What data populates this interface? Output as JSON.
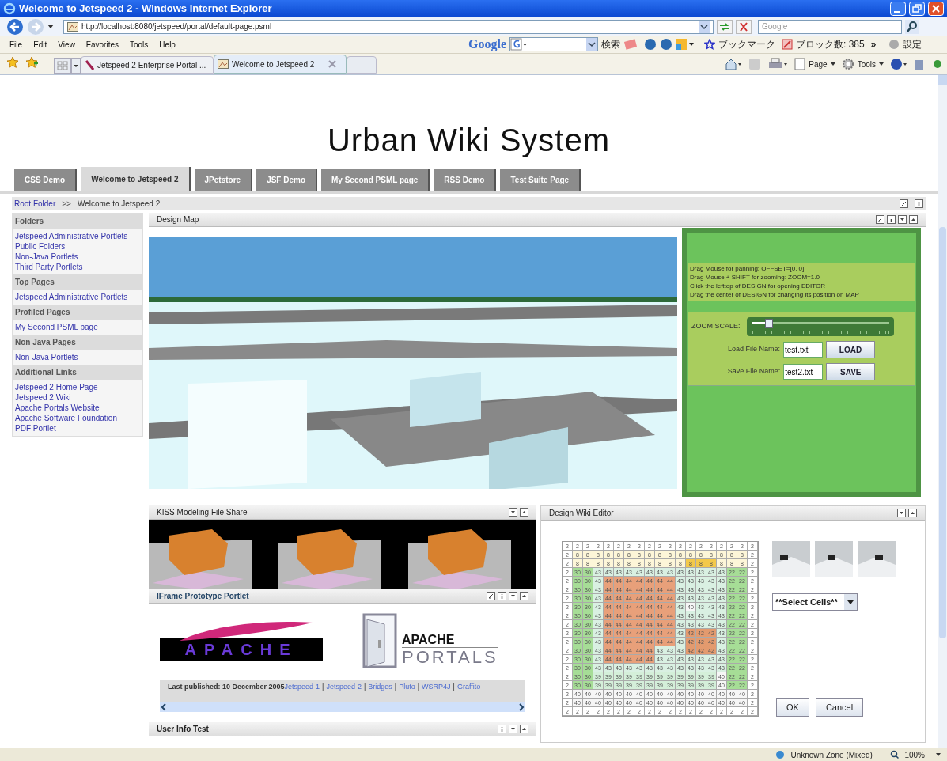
{
  "window": {
    "title": "Welcome to Jetspeed 2 - Windows Internet Explorer"
  },
  "address_bar": {
    "url": "http://localhost:8080/jetspeed/portal/default-page.psml"
  },
  "search_box": {
    "placeholder": "Google"
  },
  "menu_bar": [
    "File",
    "Edit",
    "View",
    "Favorites",
    "Tools",
    "Help"
  ],
  "google_toolbar": {
    "logo": "Google",
    "search_button": "検索",
    "bookmarks": "ブックマーク",
    "blocked": "ブロック数: 385",
    "more": "»",
    "settings": "設定"
  },
  "browser_tabs": [
    {
      "label": "Jetspeed 2 Enterprise Portal ...",
      "selected": false
    },
    {
      "label": "Welcome to Jetspeed 2",
      "selected": true
    }
  ],
  "command_bar": [
    "Page",
    "Tools"
  ],
  "page": {
    "heading": "Urban Wiki System"
  },
  "portal_tabs": [
    {
      "label": "CSS Demo",
      "selected": false
    },
    {
      "label": "Welcome to Jetspeed 2",
      "selected": true
    },
    {
      "label": "JPetstore",
      "selected": false
    },
    {
      "label": "JSF Demo",
      "selected": false
    },
    {
      "label": "My Second PSML page",
      "selected": false
    },
    {
      "label": "RSS Demo",
      "selected": false
    },
    {
      "label": "Test Suite Page",
      "selected": false
    }
  ],
  "breadcrumb": {
    "link": "Root Folder",
    "separator": ">>",
    "current": "Welcome to Jetspeed 2"
  },
  "sidebar": [
    {
      "heading": "Folders",
      "links": [
        "Jetspeed Administrative Portlets",
        "Public Folders",
        "Non-Java Portlets",
        "Third Party Portlets"
      ]
    },
    {
      "heading": "Top Pages",
      "links": [
        "Jetspeed Administrative Portlets"
      ]
    },
    {
      "heading": "Profiled Pages",
      "links": [
        "My Second PSML page"
      ]
    },
    {
      "heading": "Non Java Pages",
      "links": [
        "Non-Java Portlets"
      ]
    },
    {
      "heading": "Additional Links",
      "links": [
        "Jetspeed 2 Home Page",
        "Jetspeed 2 Wiki",
        "Apache Portals Website",
        "Apache Software Foundation",
        "PDF Portlet"
      ]
    }
  ],
  "design_map": {
    "title": "Design Map",
    "instructions": [
      "Drag Mouse for panning: OFFSET=[0, 0]",
      "Drag Mouse + SHIFT for zooming: ZOOM=1.0",
      "Click the lefttop of DESIGN for opening EDITOR",
      "Drag the center of DESIGN for changing its position on MAP"
    ],
    "zoom_label": "ZOOM SCALE:",
    "zoom": {
      "level": 0.1
    },
    "load_label": "Load File Name:",
    "load_value": "test.txt",
    "load_button": "LOAD",
    "save_label": "Save File Name:",
    "save_value": "test2.txt",
    "save_button": "SAVE"
  },
  "file_share": {
    "title": "KISS Modeling File Share"
  },
  "iframe_portlet": {
    "title": "IFrame Prototype Portlet",
    "apache_logo": "APACHE",
    "portals_logo_top": "APACHE",
    "portals_logo_bottom": "PORTALS",
    "footer_text": "Last published: 10 December 2005",
    "footer_separator": "|",
    "footer_links": [
      "Jetspeed-1",
      "Jetspeed-2",
      "Bridges",
      "Pluto",
      "WSRP4J",
      "Graffito"
    ]
  },
  "user_info": {
    "title": "User Info Test"
  },
  "wiki_editor": {
    "title": "Design Wiki Editor",
    "select": "**Select Cells**",
    "buttons": [
      "OK",
      "Cancel"
    ],
    "grid": [
      {
        "cells": [
          "2",
          "2",
          "2",
          "2",
          "2",
          "2",
          "2",
          "2",
          "2",
          "2",
          "2",
          "2",
          "2",
          "2",
          "2",
          "2",
          "2",
          "2",
          "2"
        ],
        "selected": [
          false,
          false,
          false,
          false,
          false,
          false,
          false,
          false,
          false,
          false,
          false,
          false,
          false,
          false,
          false,
          false,
          false,
          false,
          false
        ]
      },
      {
        "cells": [
          "2",
          "8",
          "8",
          "8",
          "8",
          "8",
          "8",
          "8",
          "8",
          "8",
          "8",
          "8",
          "8",
          "8",
          "8",
          "8",
          "8",
          "8",
          "2"
        ],
        "selected": [
          false,
          false,
          false,
          false,
          false,
          false,
          false,
          false,
          false,
          false,
          false,
          false,
          false,
          false,
          false,
          false,
          false,
          false,
          false
        ]
      },
      {
        "cells": [
          "2",
          "8",
          "8",
          "8",
          "8",
          "8",
          "8",
          "8",
          "8",
          "8",
          "8",
          "8",
          "8",
          "8",
          "8",
          "8",
          "8",
          "8",
          "2"
        ],
        "selected": [
          false,
          false,
          false,
          false,
          false,
          false,
          false,
          false,
          false,
          false,
          false,
          false,
          true,
          true,
          true,
          false,
          false,
          false,
          false
        ]
      },
      {
        "cells": [
          "2",
          "30",
          "30",
          "43",
          "43",
          "43",
          "43",
          "43",
          "43",
          "43",
          "43",
          "43",
          "43",
          "43",
          "43",
          "43",
          "22",
          "22",
          "2"
        ],
        "selected": [
          false,
          false,
          false,
          false,
          false,
          false,
          false,
          false,
          false,
          false,
          false,
          false,
          false,
          false,
          false,
          false,
          false,
          false,
          false
        ]
      },
      {
        "cells": [
          "2",
          "30",
          "30",
          "43",
          "44",
          "44",
          "44",
          "44",
          "44",
          "44",
          "44",
          "43",
          "43",
          "43",
          "43",
          "43",
          "22",
          "22",
          "2"
        ],
        "selected": [
          false,
          false,
          false,
          false,
          false,
          false,
          false,
          false,
          false,
          false,
          false,
          false,
          false,
          false,
          false,
          false,
          false,
          false,
          false
        ]
      },
      {
        "cells": [
          "2",
          "30",
          "30",
          "43",
          "44",
          "44",
          "44",
          "44",
          "44",
          "44",
          "44",
          "43",
          "43",
          "43",
          "43",
          "43",
          "22",
          "22",
          "2"
        ],
        "selected": [
          false,
          false,
          false,
          false,
          false,
          false,
          false,
          false,
          false,
          false,
          false,
          false,
          false,
          false,
          false,
          false,
          false,
          false,
          false
        ]
      },
      {
        "cells": [
          "2",
          "30",
          "30",
          "43",
          "44",
          "44",
          "44",
          "44",
          "44",
          "44",
          "44",
          "43",
          "43",
          "43",
          "43",
          "43",
          "22",
          "22",
          "2"
        ],
        "selected": [
          false,
          false,
          false,
          false,
          false,
          false,
          false,
          false,
          false,
          false,
          false,
          false,
          false,
          false,
          false,
          false,
          false,
          false,
          false
        ]
      },
      {
        "cells": [
          "2",
          "30",
          "30",
          "43",
          "44",
          "44",
          "44",
          "44",
          "44",
          "44",
          "44",
          "43",
          "40",
          "43",
          "43",
          "43",
          "22",
          "22",
          "2"
        ],
        "selected": [
          false,
          false,
          false,
          false,
          false,
          false,
          false,
          false,
          false,
          false,
          false,
          false,
          false,
          false,
          false,
          false,
          false,
          false,
          false
        ]
      },
      {
        "cells": [
          "2",
          "30",
          "30",
          "43",
          "44",
          "44",
          "44",
          "44",
          "44",
          "44",
          "44",
          "43",
          "43",
          "43",
          "43",
          "43",
          "22",
          "22",
          "2"
        ],
        "selected": [
          false,
          false,
          false,
          false,
          false,
          false,
          false,
          false,
          false,
          false,
          false,
          false,
          false,
          false,
          false,
          false,
          false,
          false,
          false
        ]
      },
      {
        "cells": [
          "2",
          "30",
          "30",
          "43",
          "44",
          "44",
          "44",
          "44",
          "44",
          "44",
          "44",
          "43",
          "43",
          "43",
          "43",
          "43",
          "22",
          "22",
          "2"
        ],
        "selected": [
          false,
          false,
          false,
          false,
          false,
          false,
          false,
          false,
          false,
          false,
          false,
          false,
          false,
          false,
          false,
          false,
          false,
          false,
          false
        ]
      },
      {
        "cells": [
          "2",
          "30",
          "30",
          "43",
          "44",
          "44",
          "44",
          "44",
          "44",
          "44",
          "44",
          "43",
          "42",
          "42",
          "42",
          "43",
          "22",
          "22",
          "2"
        ],
        "selected": [
          false,
          false,
          false,
          false,
          false,
          false,
          false,
          false,
          false,
          false,
          false,
          false,
          false,
          false,
          false,
          false,
          false,
          false,
          false
        ]
      },
      {
        "cells": [
          "2",
          "30",
          "30",
          "43",
          "44",
          "44",
          "44",
          "44",
          "44",
          "44",
          "44",
          "43",
          "42",
          "42",
          "42",
          "43",
          "22",
          "22",
          "2"
        ],
        "selected": [
          false,
          false,
          false,
          false,
          false,
          false,
          false,
          false,
          false,
          false,
          false,
          false,
          false,
          false,
          false,
          false,
          false,
          false,
          false
        ]
      },
      {
        "cells": [
          "2",
          "30",
          "30",
          "43",
          "44",
          "44",
          "44",
          "44",
          "44",
          "43",
          "43",
          "43",
          "42",
          "42",
          "42",
          "43",
          "22",
          "22",
          "2"
        ],
        "selected": [
          false,
          false,
          false,
          false,
          false,
          false,
          false,
          false,
          false,
          false,
          false,
          false,
          false,
          false,
          false,
          false,
          false,
          false,
          false
        ]
      },
      {
        "cells": [
          "2",
          "30",
          "30",
          "43",
          "44",
          "44",
          "44",
          "44",
          "44",
          "43",
          "43",
          "43",
          "43",
          "43",
          "43",
          "43",
          "22",
          "22",
          "2"
        ],
        "selected": [
          false,
          false,
          false,
          false,
          false,
          false,
          false,
          false,
          false,
          false,
          false,
          false,
          false,
          false,
          false,
          false,
          false,
          false,
          false
        ]
      },
      {
        "cells": [
          "2",
          "30",
          "30",
          "43",
          "43",
          "43",
          "43",
          "43",
          "43",
          "43",
          "43",
          "43",
          "43",
          "43",
          "43",
          "43",
          "22",
          "22",
          "2"
        ],
        "selected": [
          false,
          false,
          false,
          false,
          false,
          false,
          false,
          false,
          false,
          false,
          false,
          false,
          false,
          false,
          false,
          false,
          false,
          false,
          false
        ]
      },
      {
        "cells": [
          "2",
          "30",
          "30",
          "39",
          "39",
          "39",
          "39",
          "39",
          "39",
          "39",
          "39",
          "39",
          "39",
          "39",
          "39",
          "40",
          "22",
          "22",
          "2"
        ],
        "selected": [
          false,
          false,
          false,
          false,
          false,
          false,
          false,
          false,
          false,
          false,
          false,
          false,
          false,
          false,
          false,
          false,
          false,
          false,
          false
        ]
      },
      {
        "cells": [
          "2",
          "30",
          "30",
          "39",
          "39",
          "39",
          "39",
          "39",
          "39",
          "39",
          "39",
          "39",
          "39",
          "39",
          "39",
          "40",
          "22",
          "22",
          "2"
        ],
        "selected": [
          false,
          false,
          false,
          false,
          false,
          false,
          false,
          false,
          false,
          false,
          false,
          false,
          false,
          false,
          false,
          false,
          false,
          false,
          false
        ]
      },
      {
        "cells": [
          "2",
          "40",
          "40",
          "40",
          "40",
          "40",
          "40",
          "40",
          "40",
          "40",
          "40",
          "40",
          "40",
          "40",
          "40",
          "40",
          "40",
          "40",
          "2"
        ],
        "selected": [
          false,
          false,
          false,
          false,
          false,
          false,
          false,
          false,
          false,
          false,
          false,
          false,
          false,
          false,
          false,
          false,
          false,
          false,
          false
        ]
      },
      {
        "cells": [
          "2",
          "40",
          "40",
          "40",
          "40",
          "40",
          "40",
          "40",
          "40",
          "40",
          "40",
          "40",
          "40",
          "40",
          "40",
          "40",
          "40",
          "40",
          "2"
        ],
        "selected": [
          false,
          false,
          false,
          false,
          false,
          false,
          false,
          false,
          false,
          false,
          false,
          false,
          false,
          false,
          false,
          false,
          false,
          false,
          false
        ]
      },
      {
        "cells": [
          "2",
          "2",
          "2",
          "2",
          "2",
          "2",
          "2",
          "2",
          "2",
          "2",
          "2",
          "2",
          "2",
          "2",
          "2",
          "2",
          "2",
          "2",
          "2"
        ],
        "selected": [
          false,
          false,
          false,
          false,
          false,
          false,
          false,
          false,
          false,
          false,
          false,
          false,
          false,
          false,
          false,
          false,
          false,
          false,
          false
        ]
      }
    ]
  },
  "status_bar": {
    "zone": "Unknown Zone (Mixed)",
    "zoom": "100%"
  }
}
